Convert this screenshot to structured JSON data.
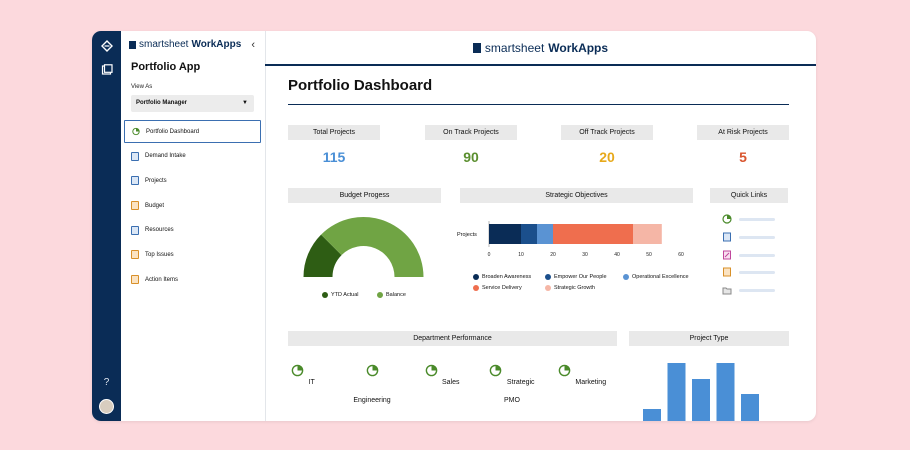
{
  "brand": {
    "prefix": "smartsheet",
    "product": "WorkApps"
  },
  "sidebar": {
    "app_title": "Portfolio App",
    "view_as_label": "View As",
    "view_as_value": "Portfolio Manager",
    "items": [
      {
        "label": "Portfolio Dashboard",
        "icon": "dashboard-icon"
      },
      {
        "label": "Demand Intake",
        "icon": "form-icon"
      },
      {
        "label": "Projects",
        "icon": "sheet-icon"
      },
      {
        "label": "Budget",
        "icon": "report-icon"
      },
      {
        "label": "Resources",
        "icon": "sheet-icon"
      },
      {
        "label": "Top Issues",
        "icon": "report-icon"
      },
      {
        "label": "Action Items",
        "icon": "report-icon"
      }
    ]
  },
  "dashboard": {
    "title": "Portfolio Dashboard",
    "kpis": [
      {
        "label": "Total Projects",
        "value": "115",
        "color": "#4a8fd6"
      },
      {
        "label": "On Track Projects",
        "value": "90",
        "color": "#5b8f2f"
      },
      {
        "label": "Off Track Projects",
        "value": "20",
        "color": "#e7a91b"
      },
      {
        "label": "At Risk Projects",
        "value": "5",
        "color": "#d9552e"
      }
    ],
    "budget": {
      "title": "Budget Progess",
      "legend": [
        {
          "label": "YTD Actual",
          "color": "#2e5d14"
        },
        {
          "label": "Balance",
          "color": "#70a444"
        }
      ]
    },
    "objectives": {
      "title": "Strategic Objectives",
      "legend": [
        {
          "label": "Broaden Awareness",
          "color": "#0a2c56"
        },
        {
          "label": "Empower Our People",
          "color": "#1b4f8c"
        },
        {
          "label": "Operational Excellence",
          "color": "#5a93d3"
        },
        {
          "label": "Service Delivery",
          "color": "#ef6e4e"
        },
        {
          "label": "Strategic Growth",
          "color": "#f5b6a6"
        }
      ]
    },
    "quick_links": {
      "title": "Quick Links",
      "items": [
        "dashboard-icon",
        "form-icon",
        "edit-icon",
        "report-icon",
        "folder-icon"
      ]
    },
    "department": {
      "title": "Department Performance",
      "items": [
        "IT",
        "Engineering",
        "Sales",
        "Strategic PMO",
        "Marketing"
      ]
    },
    "project_type": {
      "title": "Project Type"
    }
  },
  "help_label": "?",
  "chart_data": [
    {
      "type": "pie",
      "title": "Budget Progess",
      "categories": [
        "YTD Actual",
        "Balance"
      ],
      "values": [
        25,
        75
      ],
      "variant": "half-donut gauge"
    },
    {
      "type": "bar",
      "orientation": "horizontal",
      "stacked": true,
      "title": "Strategic Objectives",
      "categories": [
        "Projects"
      ],
      "series": [
        {
          "name": "Broaden Awareness",
          "values": [
            10
          ]
        },
        {
          "name": "Empower Our People",
          "values": [
            5
          ]
        },
        {
          "name": "Operational Excellence",
          "values": [
            5
          ]
        },
        {
          "name": "Service Delivery",
          "values": [
            25
          ]
        },
        {
          "name": "Strategic Growth",
          "values": [
            9
          ]
        }
      ],
      "x_ticks": [
        "0",
        "10",
        "20",
        "30",
        "40",
        "50",
        "60"
      ],
      "xlim": [
        0,
        60
      ]
    },
    {
      "type": "bar",
      "title": "Project Type",
      "values": [
        12,
        58,
        42,
        58,
        27
      ],
      "color": "#4a8fd6",
      "note": "chart cropped at bottom; values are relative bar heights, no axis shown"
    }
  ]
}
